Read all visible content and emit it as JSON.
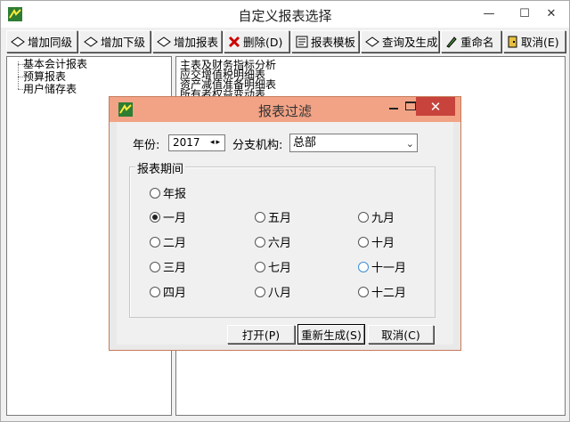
{
  "window": {
    "title": "自定义报表选择",
    "minimize": "—",
    "maximize": "☐",
    "close": "✕"
  },
  "toolbar": {
    "add_sibling": "增加同级",
    "add_child": "增加下级",
    "add_report": "增加报表",
    "delete": "删除(D)",
    "template": "报表模板",
    "query_generate": "查询及生成",
    "rename": "重命名",
    "cancel": "取消(E)"
  },
  "tree": {
    "items": [
      "基本会计报表",
      "预算报表",
      "用户储存表"
    ]
  },
  "report_list": {
    "items": [
      "主表及财务指标分析",
      "应交增值税明细表",
      "资产减值准备明细表",
      "所有者权益变动表"
    ]
  },
  "dialog": {
    "title": "报表过滤",
    "year_label": "年份:",
    "year_value": "2017",
    "year_spin": "◂▸",
    "branch_label": "分支机构:",
    "branch_value": "总部",
    "branch_arrow": "⌄",
    "period_group": "报表期间",
    "periods": {
      "annual": "年报",
      "jan": "一月",
      "feb": "二月",
      "mar": "三月",
      "apr": "四月",
      "may": "五月",
      "jun": "六月",
      "jul": "七月",
      "aug": "八月",
      "sep": "九月",
      "oct": "十月",
      "nov": "十一月",
      "dec": "十二月"
    },
    "selected_period": "一月",
    "open_button": "打开(P)",
    "regenerate_button": "重新生成(S)",
    "cancel_button": "取消(C)",
    "close": "✕"
  },
  "colors": {
    "dialog_title_bg": "#f2a386",
    "close_button_bg": "#c7433b",
    "window_bg": "#f0f0f0"
  }
}
